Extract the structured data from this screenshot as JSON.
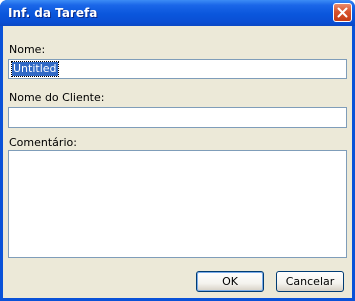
{
  "window": {
    "title": "Inf. da Tarefa"
  },
  "form": {
    "name_label": "Nome:",
    "name_value": "Untitled",
    "client_label": "Nome do Cliente:",
    "client_value": "",
    "comment_label": "Comentário:",
    "comment_value": ""
  },
  "buttons": {
    "ok_label": "OK",
    "cancel_label": "Cancelar"
  },
  "colors": {
    "title_bar": "#0a56dc",
    "close_button": "#d8532d",
    "dialog_background": "#ece9d8",
    "field_border": "#7f9db9",
    "selection": "#316ac5"
  },
  "icons": {
    "close": "close-icon"
  }
}
